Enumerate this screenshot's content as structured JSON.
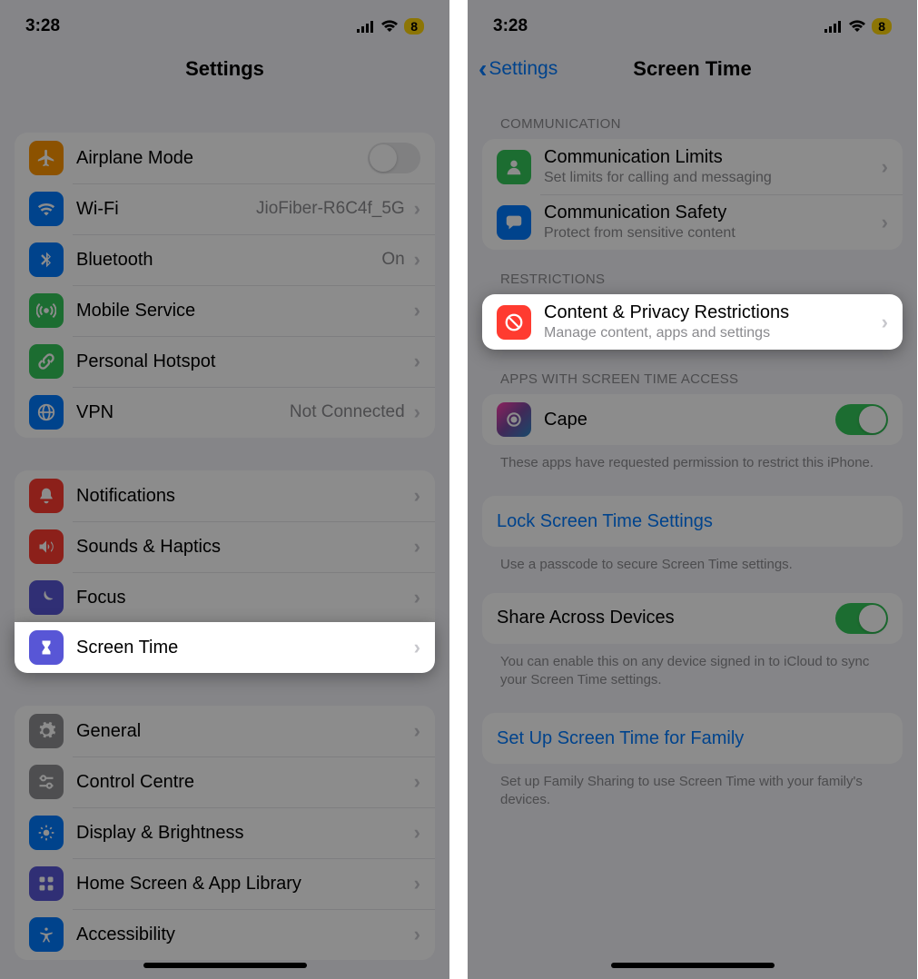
{
  "status": {
    "time": "3:28",
    "battery": "8"
  },
  "left": {
    "title": "Settings",
    "g1": [
      {
        "title": "Airplane Mode",
        "value": "",
        "control": "toggle-off",
        "icon": "airplane",
        "color": "ic-orange"
      },
      {
        "title": "Wi-Fi",
        "value": "JioFiber-R6C4f_5G",
        "control": "chevron",
        "icon": "wifi",
        "color": "ic-blue"
      },
      {
        "title": "Bluetooth",
        "value": "On",
        "control": "chevron",
        "icon": "bluetooth",
        "color": "ic-blue"
      },
      {
        "title": "Mobile Service",
        "value": "",
        "control": "chevron",
        "icon": "antenna",
        "color": "ic-green"
      },
      {
        "title": "Personal Hotspot",
        "value": "",
        "control": "chevron",
        "icon": "link",
        "color": "ic-green"
      },
      {
        "title": "VPN",
        "value": "Not Connected",
        "control": "chevron",
        "icon": "globe",
        "color": "ic-blue"
      }
    ],
    "g2": [
      {
        "title": "Notifications",
        "icon": "bell",
        "color": "ic-red"
      },
      {
        "title": "Sounds & Haptics",
        "icon": "speaker",
        "color": "ic-red"
      },
      {
        "title": "Focus",
        "icon": "moon",
        "color": "ic-indigo"
      },
      {
        "title": "Screen Time",
        "icon": "hourglass",
        "color": "ic-indigo"
      }
    ],
    "g3": [
      {
        "title": "General",
        "icon": "gear",
        "color": "ic-gray"
      },
      {
        "title": "Control Centre",
        "icon": "sliders",
        "color": "ic-gray"
      },
      {
        "title": "Display & Brightness",
        "icon": "display",
        "color": "ic-blue"
      },
      {
        "title": "Home Screen & App Library",
        "icon": "grid",
        "color": "ic-indigo"
      },
      {
        "title": "Accessibility",
        "icon": "accessibility",
        "color": "ic-blue"
      }
    ]
  },
  "right": {
    "back": "Settings",
    "title": "Screen Time",
    "sec_comm_header": "COMMUNICATION",
    "comm": [
      {
        "title": "Communication Limits",
        "sub": "Set limits for calling and messaging",
        "icon": "person",
        "color": "ic-green"
      },
      {
        "title": "Communication Safety",
        "sub": "Protect from sensitive content",
        "icon": "bubble",
        "color": "ic-blue"
      }
    ],
    "sec_restr_header": "RESTRICTIONS",
    "restr": {
      "title": "Content & Privacy Restrictions",
      "sub": "Manage content, apps and settings",
      "icon": "nosign",
      "color": "ic-red"
    },
    "sec_apps_header": "APPS WITH SCREEN TIME ACCESS",
    "app": {
      "title": "Cape"
    },
    "apps_footer": "These apps have requested permission to restrict this iPhone.",
    "lock": {
      "title": "Lock Screen Time Settings"
    },
    "lock_footer": "Use a passcode to secure Screen Time settings.",
    "share": {
      "title": "Share Across Devices"
    },
    "share_footer": "You can enable this on any device signed in to iCloud to sync your Screen Time settings.",
    "family": {
      "title": "Set Up Screen Time for Family"
    },
    "family_footer": "Set up Family Sharing to use Screen Time with your family's devices."
  }
}
